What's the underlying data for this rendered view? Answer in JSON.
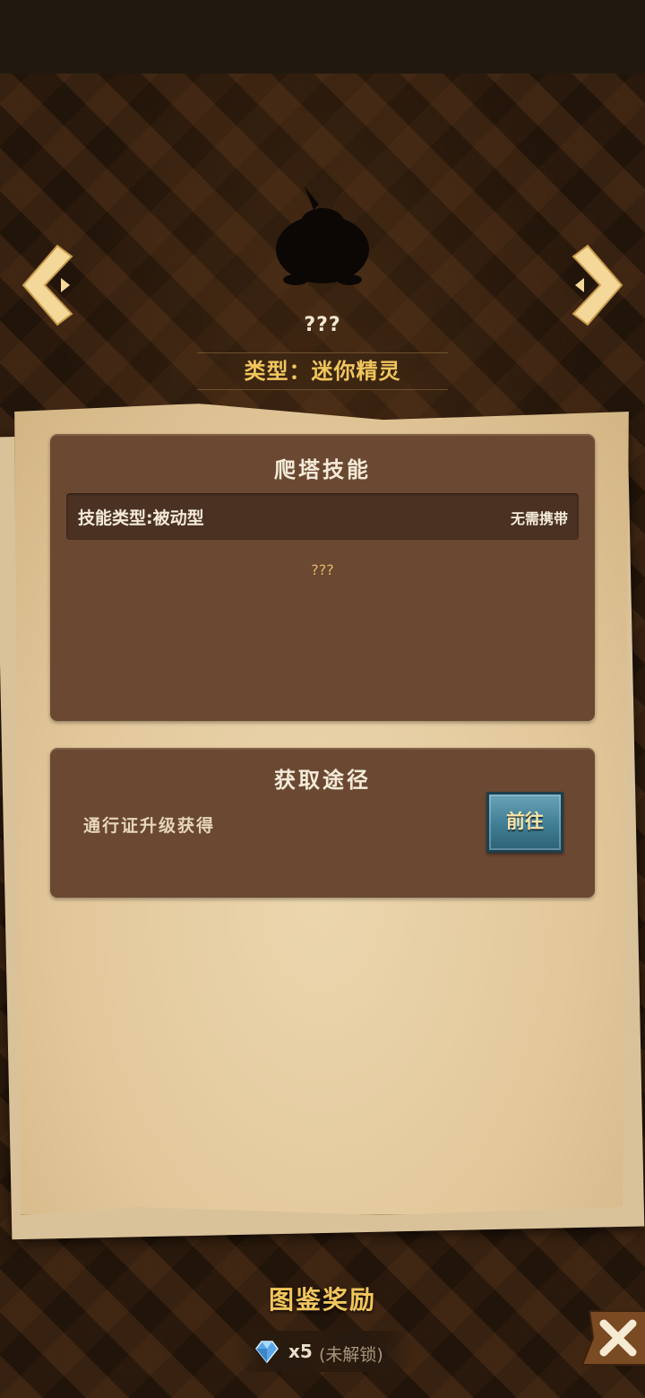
{
  "creature": {
    "name": "???",
    "type_label": "类型：迷你精灵",
    "silhouette_icon": "creature-silhouette-icon"
  },
  "nav": {
    "prev_icon": "chevron-left-icon",
    "next_icon": "chevron-right-icon"
  },
  "skill_card": {
    "title": "爬塔技能",
    "skill_type": "技能类型:被动型",
    "carry_note": "无需携带",
    "description": "???"
  },
  "source_card": {
    "title": "获取途径",
    "source_text": "通行证升级获得",
    "go_button_label": "前往"
  },
  "reward": {
    "title": "图鉴奖励",
    "icon": "diamond-gem-icon",
    "count": "x5",
    "lock_status": "(未解锁)"
  },
  "close_icon": "close-x-icon",
  "colors": {
    "gold_text": "#f1c65c",
    "card_brown": "#6a4832",
    "paper": "#e2c79a",
    "button_teal": "#3f7d94"
  }
}
